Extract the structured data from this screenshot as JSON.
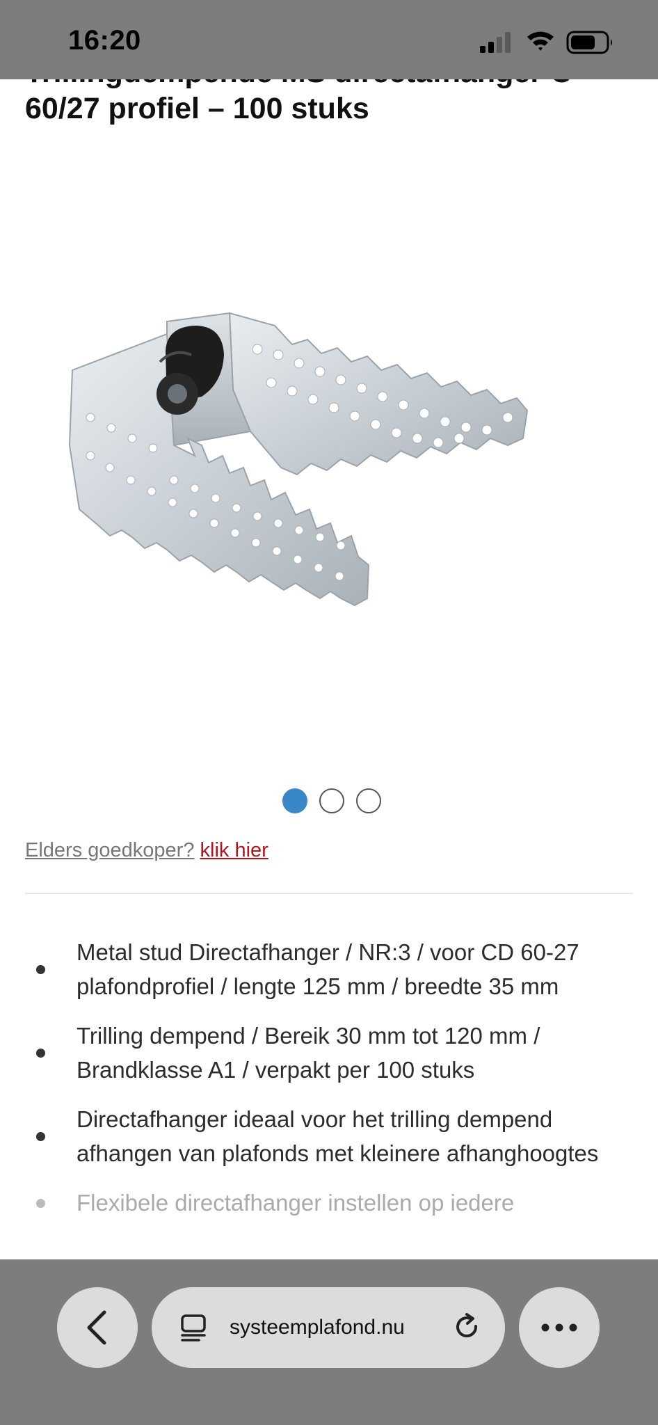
{
  "status_bar": {
    "time": "16:20",
    "signal_bars": 2,
    "battery_level": 0.7
  },
  "product": {
    "title_lines": [
      "Trillingdempende MS directafhanger C",
      "60/27 profiel – 100 stuks"
    ],
    "image_icon": "ceiling-hanger-product-photo"
  },
  "gallery": {
    "slide_count": 3,
    "active_index": 0,
    "active_color": "#3a87c8"
  },
  "price_notice": {
    "text": "Elders goedkoper?",
    "link_text": "klik hier",
    "link_color": "#b3151c"
  },
  "features": [
    "Metal stud Directafhanger / NR:3 / voor CD 60-27 plafondprofiel / lengte 125 mm / breedte 35 mm",
    "Trilling dempend / Bereik 30 mm tot 120 mm / Brandklasse A1 / verpakt per 100 stuks",
    "Directafhanger ideaal voor het trilling dempend afhangen van plafonds met kleinere afhanghoogtes",
    "Flexibele directafhanger instellen op iedere"
  ],
  "browser_bar": {
    "url": "systeemplafond.nu",
    "back_icon": "chevron-left-icon",
    "tabs_icon": "tabs-icon",
    "reload_icon": "reload-icon",
    "more_icon": "ellipsis-icon"
  }
}
